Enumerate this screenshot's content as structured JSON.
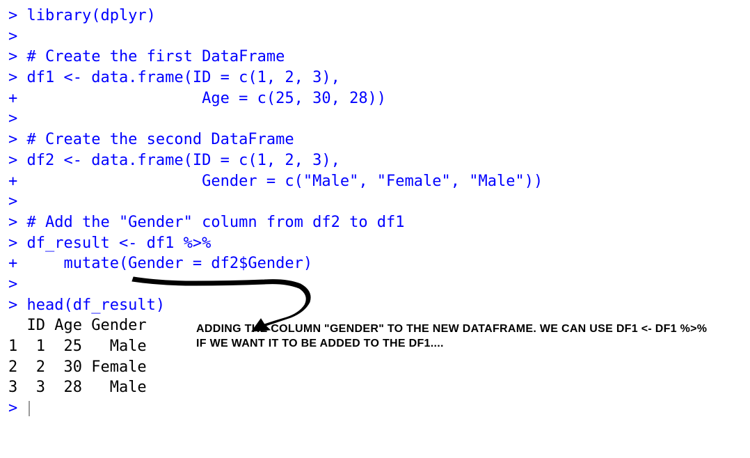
{
  "lines": {
    "l1": "> library(dplyr)",
    "l2": ">",
    "l3": "> # Create the first DataFrame",
    "l4": "> df1 <- data.frame(ID = c(1, 2, 3),",
    "l5": "+                    Age = c(25, 30, 28))",
    "l6": ">",
    "l7": "> # Create the second DataFrame",
    "l8": "> df2 <- data.frame(ID = c(1, 2, 3),",
    "l9": "+                    Gender = c(\"Male\", \"Female\", \"Male\"))",
    "l10": ">",
    "l11": "> # Add the \"Gender\" column from df2 to df1",
    "l12": "> df_result <- df1 %>%",
    "l13": "+     mutate(Gender = df2$Gender)",
    "l14": ">",
    "l15": "> head(df_result)"
  },
  "output": {
    "header": "  ID Age Gender",
    "r1": "1  1  25   Male",
    "r2": "2  2  30 Female",
    "r3": "3  3  28   Male"
  },
  "prompt": "> ",
  "annotation": "ADDING THE COLUMN \"GENDER\" TO THE NEW DATAFRAME. WE CAN USE DF1 <- DF1 %>% IF WE WANT IT TO BE ADDED TO THE DF1...."
}
